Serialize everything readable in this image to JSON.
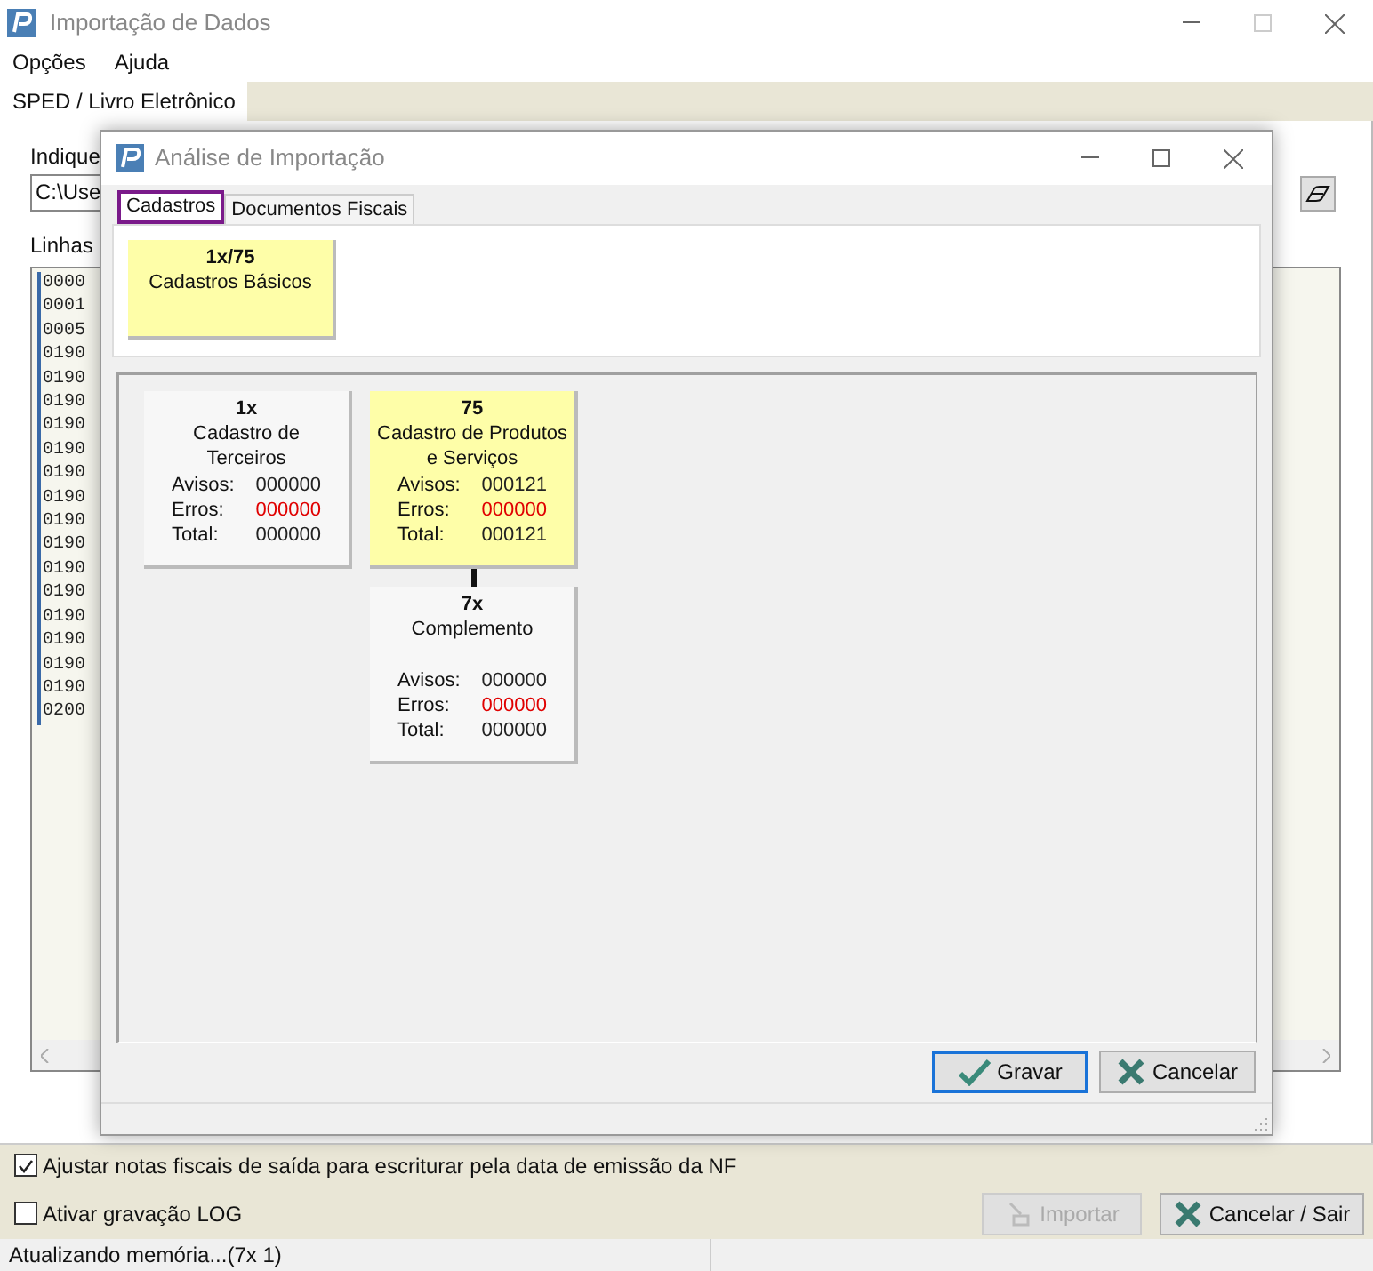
{
  "window": {
    "title": "Importação de Dados"
  },
  "menu": [
    "Opções",
    "Ajuda"
  ],
  "tabs": [
    {
      "label": "SPED / Livro Eletrônico",
      "selected": true
    }
  ],
  "file_label": "Indique",
  "file_path": "C:\\Use",
  "lines_label": "Linhas",
  "lines": [
    "0000",
    "0001",
    "0005",
    "0190",
    "0190",
    "0190",
    "0190",
    "0190",
    "0190",
    "0190",
    "0190",
    "0190",
    "0190",
    "0190",
    "0190",
    "0190",
    "0190",
    "0190",
    "0200"
  ],
  "dialog": {
    "title": "Análise de Importação",
    "tabs": [
      {
        "label": "Cadastros",
        "selected": true
      },
      {
        "label": "Documentos Fiscais",
        "selected": false
      }
    ],
    "groups": [
      {
        "count": "1x/75",
        "title": "Cadastros Básicos",
        "highlighted": true
      }
    ],
    "cards": [
      {
        "count": "1x",
        "title": "Cadastro de Terceiros",
        "highlighted": false,
        "stats": [
          {
            "label": "Avisos:",
            "value": "000000",
            "kind": "warning"
          },
          {
            "label": "Erros:",
            "value": "000000",
            "kind": "error"
          },
          {
            "label": "Total:",
            "value": "000000",
            "kind": "total"
          }
        ]
      },
      {
        "count": "75",
        "title": "Cadastro de Produtos e Serviços",
        "highlighted": true,
        "stats": [
          {
            "label": "Avisos:",
            "value": "000121",
            "kind": "warning"
          },
          {
            "label": "Erros:",
            "value": "000000",
            "kind": "error"
          },
          {
            "label": "Total:",
            "value": "000121",
            "kind": "total"
          }
        ],
        "children": [
          {
            "count": "7x",
            "title": "Complemento",
            "highlighted": false,
            "stats": [
              {
                "label": "Avisos:",
                "value": "000000",
                "kind": "warning"
              },
              {
                "label": "Erros:",
                "value": "000000",
                "kind": "error"
              },
              {
                "label": "Total:",
                "value": "000000",
                "kind": "total"
              }
            ]
          }
        ]
      }
    ],
    "buttons": [
      {
        "label": "Gravar",
        "kind": "save",
        "default": true
      },
      {
        "label": "Cancelar",
        "kind": "cancel",
        "default": false
      }
    ]
  },
  "options": [
    {
      "label": "Ajustar notas fiscais de saída para escriturar pela data de emissão da NF",
      "checked": true
    },
    {
      "label": "Ativar gravação LOG",
      "checked": false
    }
  ],
  "actions": [
    {
      "label": "Importar",
      "kind": "import",
      "disabled": true
    },
    {
      "label": "Cancelar / Sair",
      "kind": "cancel",
      "disabled": false
    }
  ],
  "status_bar": [
    "Atualizando memória...(7x 1)"
  ]
}
